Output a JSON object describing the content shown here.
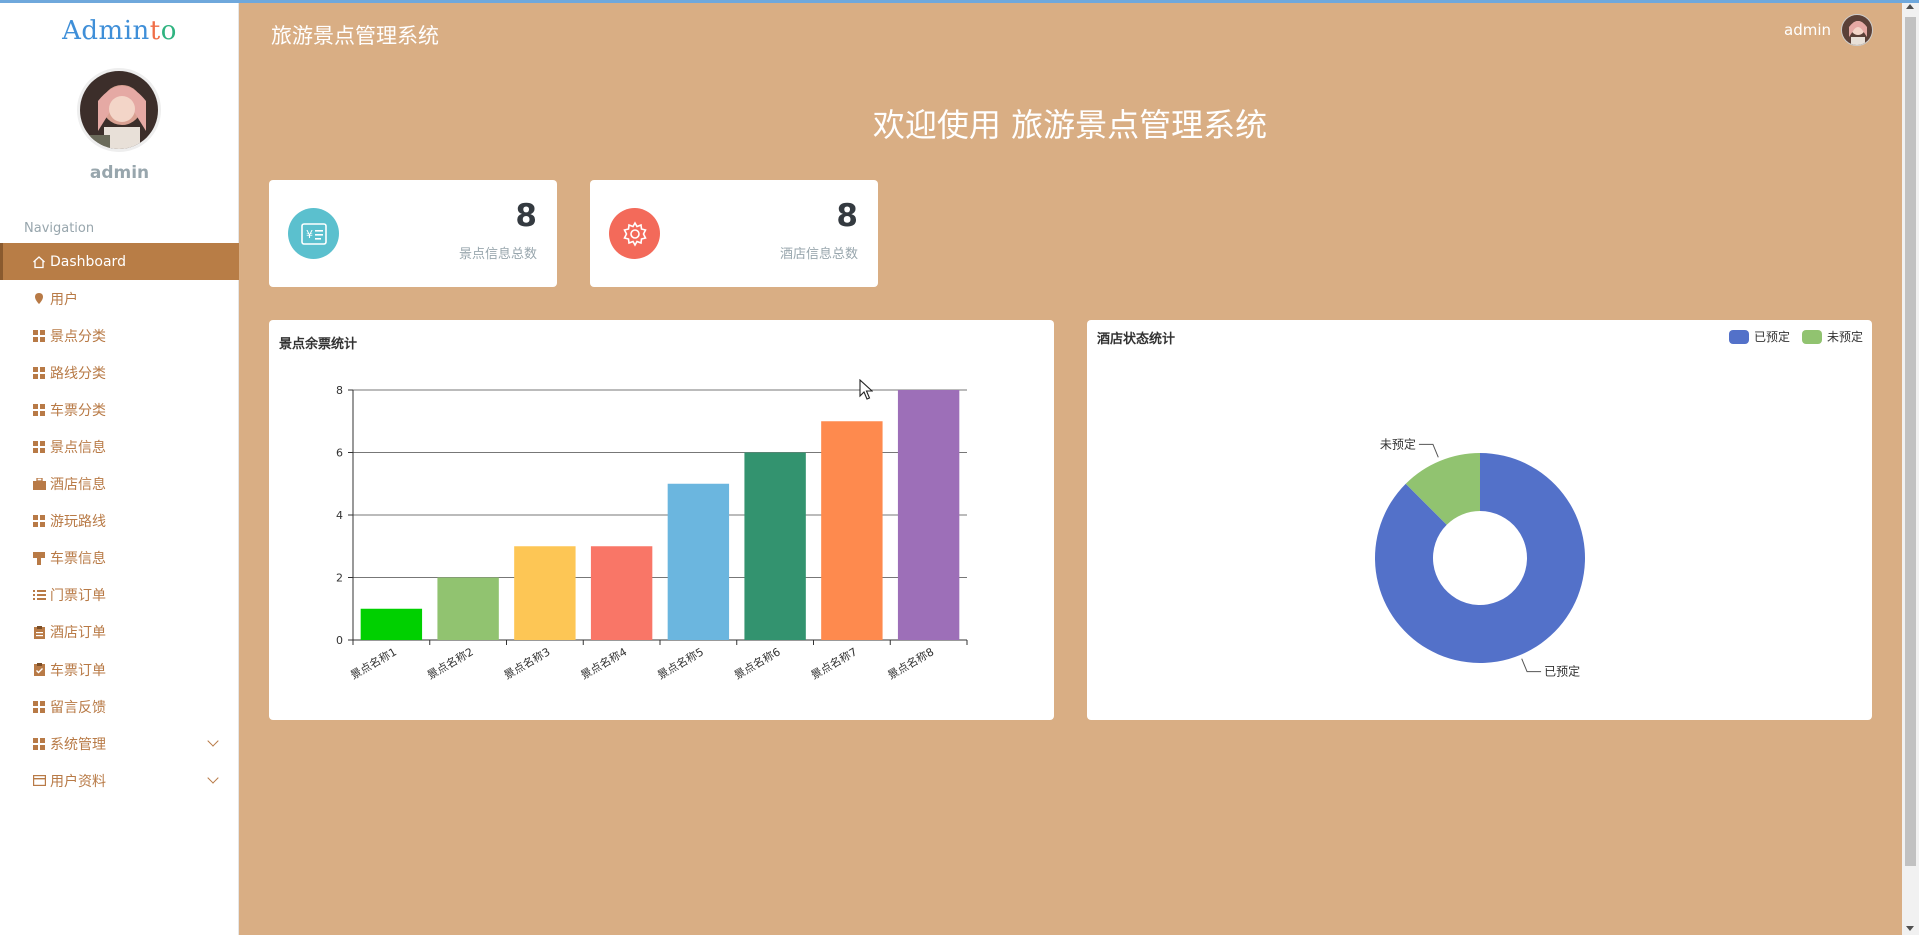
{
  "logo": {
    "part1": "Admin",
    "part2": "t",
    "part3": "o"
  },
  "sidebar": {
    "username": "admin",
    "nav_title": "Navigation",
    "items": [
      {
        "label": "Dashboard",
        "icon": "home-icon"
      },
      {
        "label": "用户",
        "icon": "pin-icon"
      },
      {
        "label": "景点分类",
        "icon": "grid-icon"
      },
      {
        "label": "路线分类",
        "icon": "grid-icon"
      },
      {
        "label": "车票分类",
        "icon": "grid-icon"
      },
      {
        "label": "景点信息",
        "icon": "grid-icon"
      },
      {
        "label": "酒店信息",
        "icon": "briefcase-icon"
      },
      {
        "label": "游玩路线",
        "icon": "grid-icon"
      },
      {
        "label": "车票信息",
        "icon": "stamp-icon"
      },
      {
        "label": "门票订单",
        "icon": "list-icon"
      },
      {
        "label": "酒店订单",
        "icon": "clipboard-icon"
      },
      {
        "label": "车票订单",
        "icon": "clipboard-check-icon"
      },
      {
        "label": "留言反馈",
        "icon": "grid-icon"
      },
      {
        "label": "系统管理",
        "icon": "grid-icon"
      },
      {
        "label": "用户资料",
        "icon": "card-icon"
      }
    ]
  },
  "header": {
    "app_title": "旅游景点管理系统",
    "user": "admin"
  },
  "welcome": "欢迎使用 旅游景点管理系统",
  "stats": [
    {
      "value": "8",
      "label": "景点信息总数",
      "icon": "ticket-icon",
      "color": "#5bc0ce"
    },
    {
      "value": "8",
      "label": "酒店信息总数",
      "icon": "gear-icon",
      "color": "#f36a5a"
    }
  ],
  "chart_data": [
    {
      "type": "bar",
      "title": "景点余票统计",
      "categories": [
        "景点名称1",
        "景点名称2",
        "景点名称3",
        "景点名称4",
        "景点名称5",
        "景点名称6",
        "景点名称7",
        "景点名称8"
      ],
      "values": [
        1,
        2,
        3,
        3,
        5,
        6,
        7,
        8
      ],
      "colors": [
        "#00d000",
        "#91c370",
        "#fdc655",
        "#f97667",
        "#6bb6df",
        "#33936f",
        "#fe8a4e",
        "#9d6fb8"
      ],
      "ylim": [
        0,
        8
      ],
      "yticks": [
        0,
        2,
        4,
        6,
        8
      ],
      "grid": true
    },
    {
      "type": "pie",
      "title": "酒店状态统计",
      "labels": [
        "已预定",
        "未预定"
      ],
      "values": [
        7,
        1
      ],
      "colors": [
        "#5371c9",
        "#91c370"
      ],
      "legend": "top-right"
    }
  ]
}
